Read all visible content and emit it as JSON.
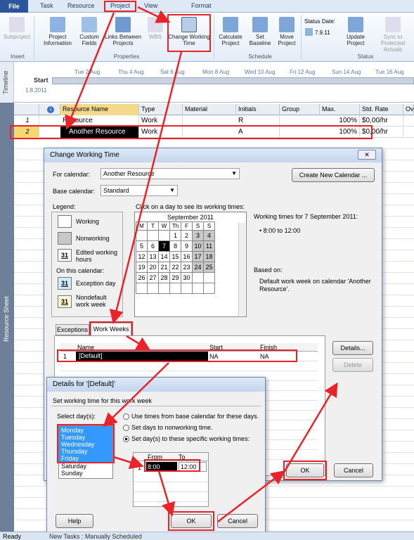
{
  "ribbon": {
    "tabs": [
      "File",
      "Task",
      "Resource",
      "Project",
      "View",
      "Format"
    ],
    "buttons": {
      "subproject": "Subproject",
      "project_information": "Project Information",
      "custom_fields": "Custom Fields",
      "links_between_projects": "Links Between Projects",
      "wbs": "WBS",
      "change_working_time": "Change Working Time",
      "calculate_project": "Calculate Project",
      "set_baseline": "Set Baseline",
      "move_project": "Move Project",
      "status_date_label": "Status Date:",
      "status_date_value": "7.9.11",
      "update_project": "Update Project",
      "sync_protected": "Sync to Protected Actuals"
    },
    "groups": [
      "Insert",
      "Properties",
      "Schedule",
      "Status"
    ]
  },
  "timeline": {
    "side_label": "Timeline",
    "start_label": "Start",
    "start_date": "1.8.2011",
    "dates": [
      "Tue 2 Aug",
      "Thu 4 Aug",
      "Sat 6 Aug",
      "Mon 8 Aug",
      "Wed 10 Aug",
      "Fri 12 Aug",
      "Sun 14 Aug",
      "Tue 16 Aug"
    ]
  },
  "sheet": {
    "side_label": "Resource Sheet",
    "columns": [
      "Resource Name",
      "Type",
      "Material",
      "Initials",
      "Group",
      "Max.",
      "Std. Rate",
      "Ov"
    ],
    "rows": [
      {
        "num": "1",
        "name": "Resource",
        "type": "Work",
        "initials": "R",
        "max": "100%",
        "rate": "$0,00/hr"
      },
      {
        "num": "2",
        "name": "Another Resource",
        "type": "Work",
        "initials": "A",
        "max": "100%",
        "rate": "$0,00/hr"
      }
    ]
  },
  "cwt_dialog": {
    "title": "Change Working Time",
    "for_calendar_label": "For calendar:",
    "for_calendar_value": "Another Resource",
    "create_new": "Create New Calendar ...",
    "base_calendar_label": "Base calendar:",
    "base_calendar_value": "Standard",
    "legend_title": "Legend:",
    "legend": {
      "working": "Working",
      "nonworking": "Nonworking",
      "edited": "Edited working hours",
      "on_this": "On this calendar:",
      "exception": "Exception day",
      "nondefault": "Nondefault work week",
      "num": "31"
    },
    "click_hint": "Click on a day to see its working times:",
    "month": "September 2011",
    "weekdays": [
      "M",
      "T",
      "W",
      "Th",
      "F",
      "S",
      "S"
    ],
    "working_times_title": "Working times for 7 September 2011:",
    "working_time": "• 8:00 to 12:00",
    "based_on": "Based on:",
    "based_on_text": "Default work week on calendar 'Another Resource'.",
    "tabs": [
      "Exceptions",
      "Work Weeks"
    ],
    "ww_columns": [
      "Name",
      "Start",
      "Finish"
    ],
    "ww_row": {
      "num": "1",
      "name": "[Default]",
      "start": "NA",
      "finish": "NA"
    },
    "details_btn": "Details...",
    "delete_btn": "Delete",
    "ok": "OK",
    "cancel": "Cancel"
  },
  "details_dialog": {
    "title": "Details for '[Default]'",
    "section": "Set working time for this work week",
    "select_days": "Select day(s):",
    "days": [
      "Monday",
      "Tuesday",
      "Wednesday",
      "Thursday",
      "Friday",
      "Saturday",
      "Sunday"
    ],
    "opt1": "Use times from base calendar for these days.",
    "opt2": "Set days to nonworking time.",
    "opt3": "Set day(s) to these specific working times:",
    "from": "From",
    "to": "To",
    "row": {
      "num": "1",
      "from": "8:00",
      "to": "12:00"
    },
    "help": "Help",
    "ok": "OK",
    "cancel": "Cancel"
  },
  "status_bar": {
    "ready": "Ready",
    "tab": "New Tasks : Manually Scheduled"
  }
}
